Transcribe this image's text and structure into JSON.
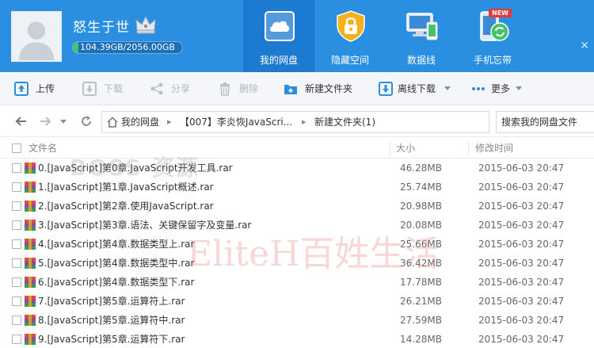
{
  "header": {
    "username": "怒生于世",
    "quota_text": "104.39GB/2056.00GB",
    "quota_used_fraction": 0.0508,
    "nav": [
      {
        "label": "我的网盘",
        "icon": "cloud-icon",
        "active": true
      },
      {
        "label": "隐藏空间",
        "icon": "lock-icon",
        "active": false
      },
      {
        "label": "数据线",
        "icon": "devices-icon",
        "active": false
      },
      {
        "label": "手机忘带",
        "icon": "phone-sync-icon",
        "active": false,
        "badge": "NEW"
      }
    ]
  },
  "toolbar": {
    "upload": "上传",
    "download": "下载",
    "share": "分享",
    "delete": "删除",
    "new_folder": "新建文件夹",
    "offline_download": "离线下载",
    "more": "更多"
  },
  "address": {
    "crumbs": [
      "我的网盘",
      "【007】李炎恢JavaScri...",
      "新建文件夹(1)"
    ],
    "search_placeholder": "搜索我的网盘文件"
  },
  "list": {
    "columns": {
      "name": "文件名",
      "size": "大小",
      "modified": "修改时间"
    },
    "files": [
      {
        "name": "0.[JavaScript]第0章.JavaScript开发工具.rar",
        "size": "46.28MB",
        "date": "2015-06-03 20:47"
      },
      {
        "name": "1.[JavaScript]第1章.JavaScript概述.rar",
        "size": "25.74MB",
        "date": "2015-06-03 20:47"
      },
      {
        "name": "2.[JavaScript]第2章.使用JavaScript.rar",
        "size": "20.98MB",
        "date": "2015-06-03 20:47"
      },
      {
        "name": "3.[JavaScript]第3章.语法、关键保留字及变量.rar",
        "size": "20.08MB",
        "date": "2015-06-03 20:47"
      },
      {
        "name": "4.[JavaScript]第4章.数据类型上.rar",
        "size": "25.66MB",
        "date": "2015-06-03 20:47"
      },
      {
        "name": "5.[JavaScript]第4章.数据类型中.rar",
        "size": "36.42MB",
        "date": "2015-06-03 20:47"
      },
      {
        "name": "6.[JavaScript]第4章.数据类型下.rar",
        "size": "17.78MB",
        "date": "2015-06-03 20:47"
      },
      {
        "name": "7.[JavaScript]第5章.运算符上.rar",
        "size": "26.21MB",
        "date": "2015-06-03 20:47"
      },
      {
        "name": "8.[JavaScript]第5章.运算符中.rar",
        "size": "27.59MB",
        "date": "2015-06-03 20:47"
      },
      {
        "name": "9.[JavaScript]第5章.运算符下.rar",
        "size": "14.28MB",
        "date": "2015-06-03 20:47"
      }
    ]
  },
  "watermarks": {
    "top": "BOSS 资源",
    "center": "EliteH百姓生活"
  },
  "colors": {
    "header_bg": "#2a8fe0",
    "nav_active_bg": "#1c7ad0",
    "quota_fill": "#46c36a",
    "toolbar_bg": "#f4f6f9"
  }
}
